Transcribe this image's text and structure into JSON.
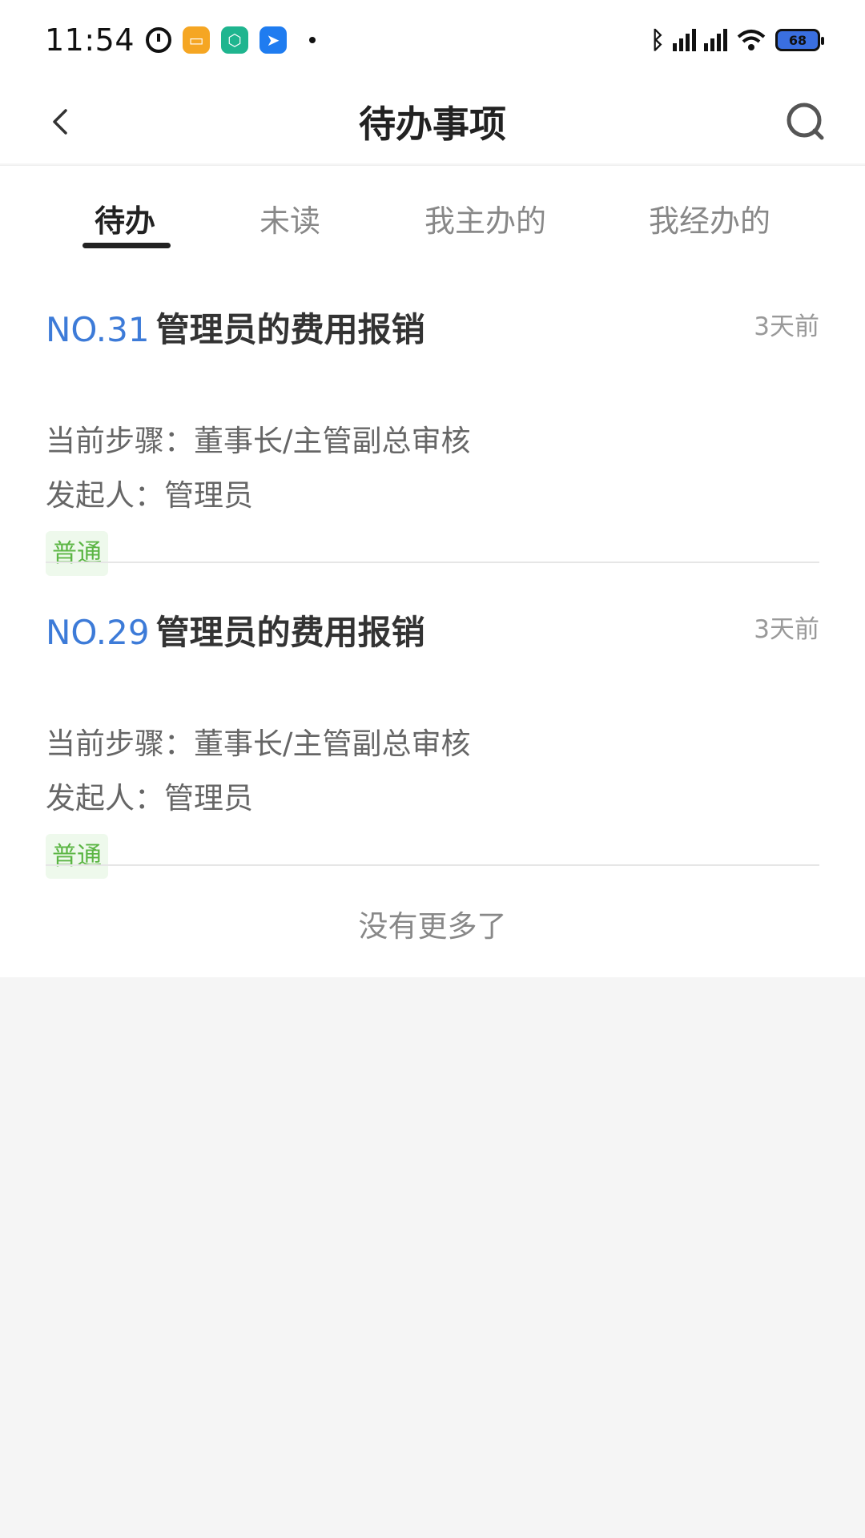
{
  "status_bar": {
    "time": "11:54",
    "battery": "68",
    "icons": [
      "alarm-icon",
      "notes-app-icon",
      "security-app-icon",
      "dingtalk-app-icon",
      "bluetooth-icon",
      "signal-icon",
      "wifi-icon",
      "battery-icon"
    ]
  },
  "header": {
    "title": "待办事项",
    "back_icon": "chevron-left-icon",
    "search_icon": "search-icon"
  },
  "tabs": [
    {
      "label": "待办",
      "active": true
    },
    {
      "label": "未读",
      "active": false
    },
    {
      "label": "我主办的",
      "active": false
    },
    {
      "label": "我经办的",
      "active": false
    }
  ],
  "items": [
    {
      "no": "NO.31",
      "title": "管理员的费用报销",
      "time": "3天前",
      "step": "当前步骤：董事长/主管副总审核",
      "initiator": "发起人：管理员",
      "priority": "普通"
    },
    {
      "no": "NO.29",
      "title": "管理员的费用报销",
      "time": "3天前",
      "step": "当前步骤：董事长/主管副总审核",
      "initiator": "发起人：管理员",
      "priority": "普通"
    }
  ],
  "footer_text": "没有更多了",
  "colors": {
    "accent_blue": "#3d7bd8",
    "tag_green": "#5cb645",
    "tag_bg": "#eef9ec",
    "background": "#f5f5f5"
  }
}
